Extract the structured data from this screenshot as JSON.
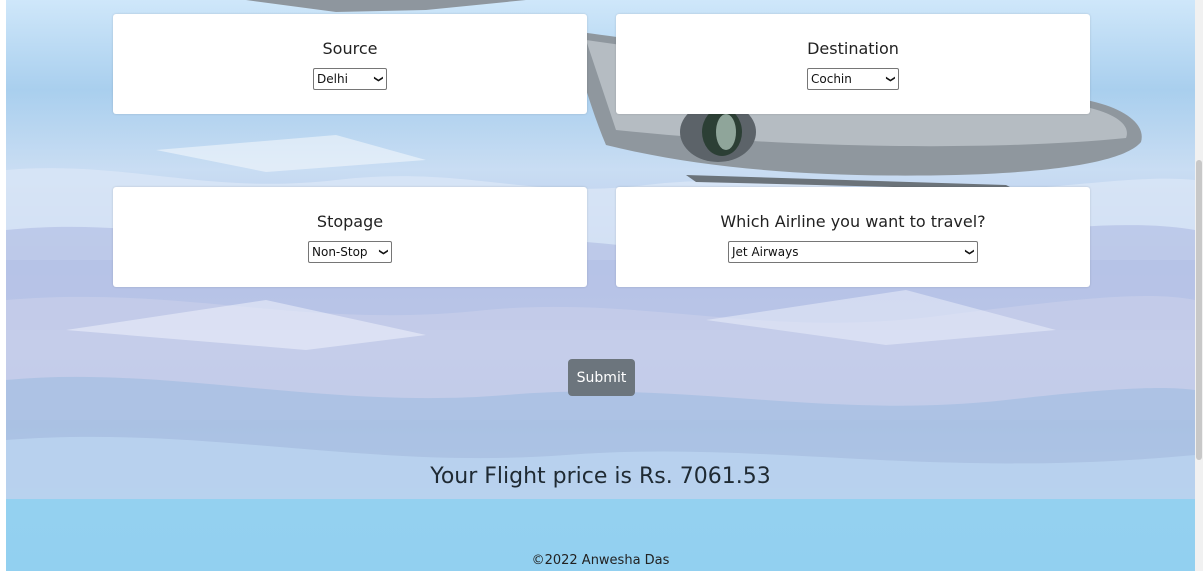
{
  "form": {
    "source": {
      "label": "Source",
      "value": "Delhi"
    },
    "destination": {
      "label": "Destination",
      "value": "Cochin"
    },
    "stopage": {
      "label": "Stopage",
      "value": "Non-Stop"
    },
    "airline": {
      "label": "Which Airline you want to travel?",
      "value": "Jet Airways"
    }
  },
  "submit_label": "Submit",
  "result_text": "Your Flight price is Rs. 7061.53",
  "footer_text": "©2022 Anwesha Das",
  "icons": {
    "dropdown": "chevron-down-icon"
  },
  "colors": {
    "button": "#6c757d",
    "card": "#ffffff",
    "footer_bg": "#a6d9f2"
  }
}
